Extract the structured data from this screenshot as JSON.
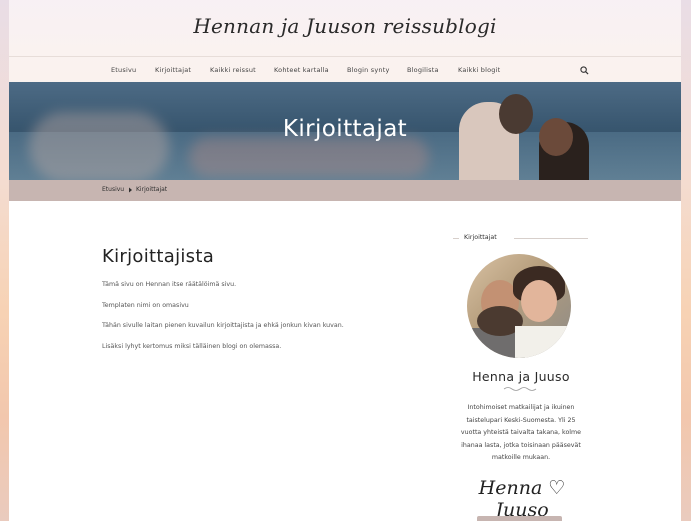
{
  "site": {
    "title": "Hennan ja Juuson reissublogi"
  },
  "nav": {
    "items": [
      "Etusivu",
      "Kirjoittajat",
      "Kaikki reissut",
      "Kohteet kartalla",
      "Blogin synty",
      "Blogilista",
      "Kaikki blogit"
    ],
    "search_icon": "search-icon"
  },
  "hero": {
    "title": "Kirjoittajat"
  },
  "breadcrumb": {
    "home": "Etusivu",
    "separator_icon": "chevron-right-icon",
    "current": "Kirjoittajat"
  },
  "content": {
    "title": "Kirjoittajista",
    "paragraphs": [
      "Tämä sivu on Hennan itse räätälöimä sivu.",
      "Templaten nimi on omasivu",
      "Tähän sivulle laitan pienen kuvailun kirjoittajista ja ehkä jonkun kivan kuvan.",
      "Lisäksi lyhyt kertomus miksi tälläinen blogi on olemassa."
    ]
  },
  "sidebar": {
    "widget_title": "Kirjoittajat",
    "name": "Henna ja Juuso",
    "bio_lines": [
      "Intohimoiset matkailijat ja ikuinen",
      "taistelupari Keski-Suomesta. Yli 25",
      "vuotta yhteistä taivalta takana, kolme",
      "ihanaa lasta, jotka toisinaan pääsevät",
      "matkoille mukaan."
    ],
    "signature": "Henna ♡ Juuso"
  },
  "colors": {
    "breadcrumb_bar": "#c7b5b1",
    "text_dark": "#222222",
    "hero_overlay": "#395770"
  }
}
